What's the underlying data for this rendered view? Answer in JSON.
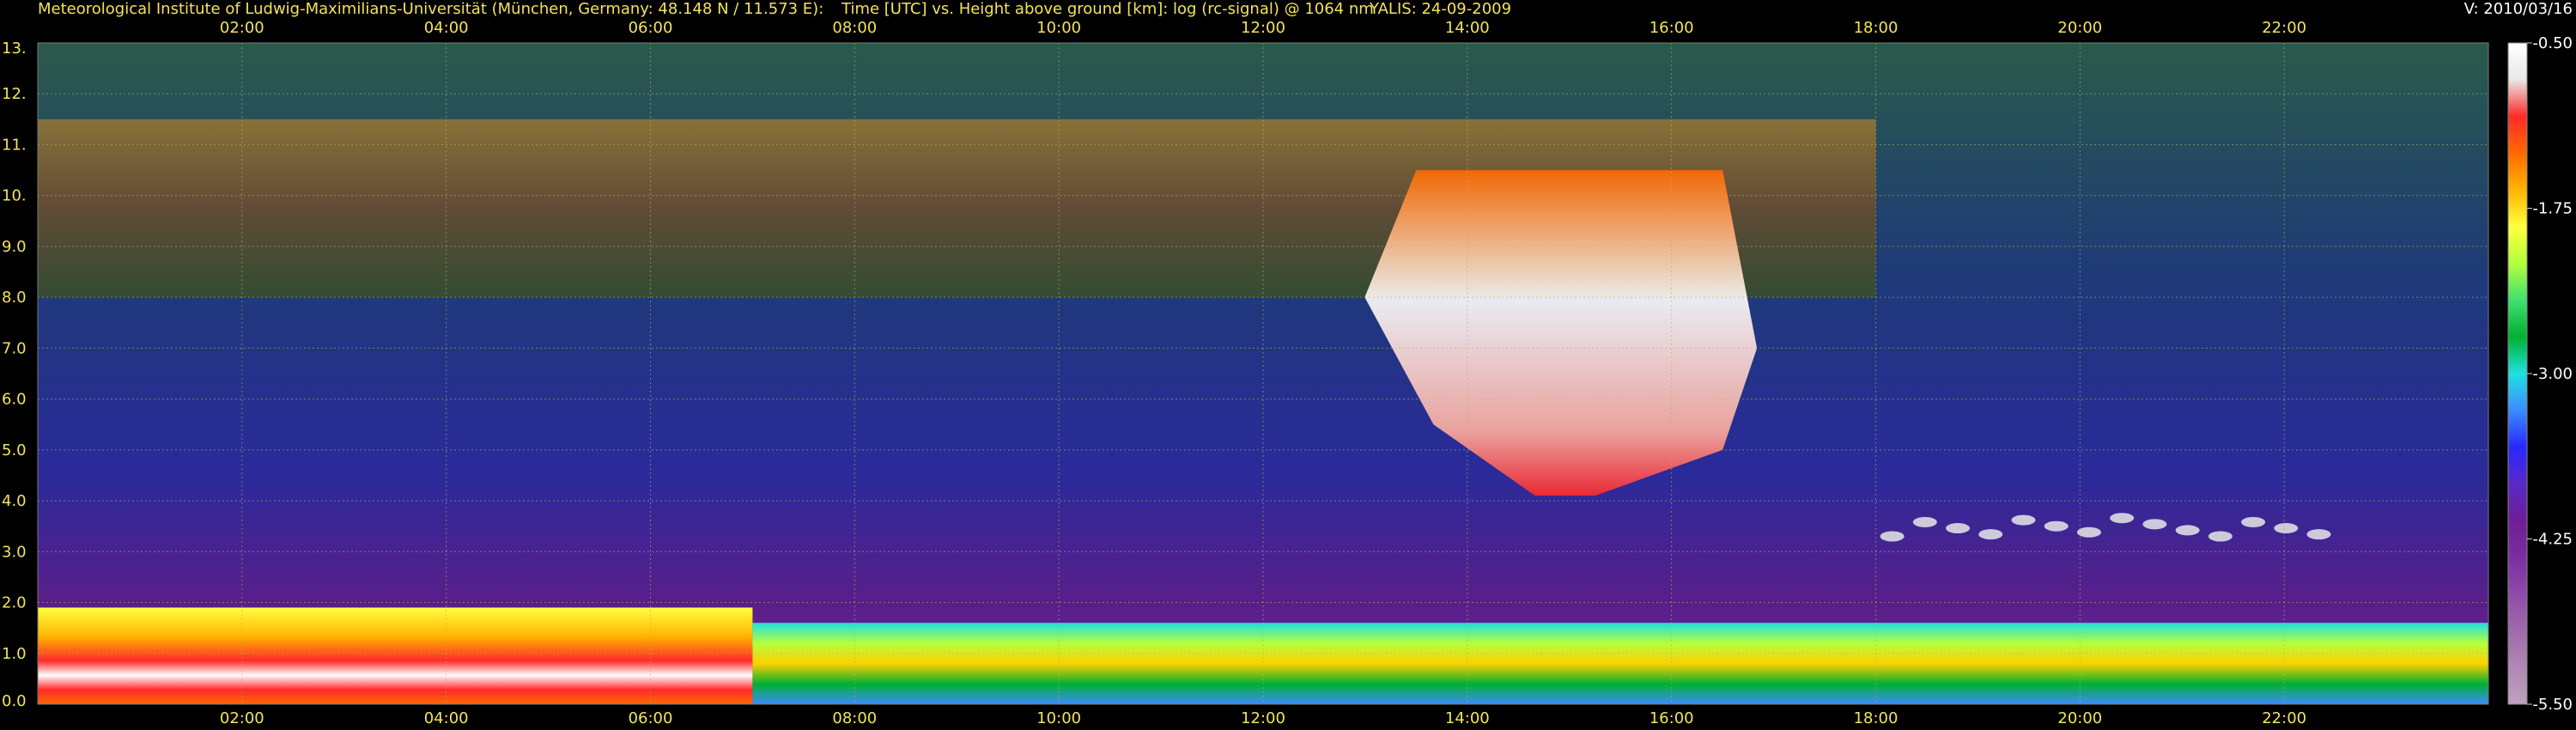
{
  "header": {
    "institute": "Meteorological Institute of Ludwig-Maximilians-Universität (München, Germany: 48.148 N / 11.573 E):",
    "plot_title": "Time [UTC] vs. Height above ground [km]: log (rc-signal) @ 1064 nm",
    "instrument": "YALIS: 24-09-2009",
    "version": "V: 2010/03/16"
  },
  "colors": {
    "header_text": "#f2e35a",
    "grid": "#b8b060",
    "background": "#000000"
  },
  "chart_data": {
    "type": "heatmap",
    "title": "Time [UTC] vs. Height above ground [km]: log (rc-signal) @ 1064 nm",
    "x_unit": "Time [UTC]",
    "y_unit": "Height above ground [km]",
    "xlim": [
      0.0,
      24.0
    ],
    "ylim": [
      0.0,
      13.0
    ],
    "x_ticks": [
      "02:00",
      "04:00",
      "06:00",
      "08:00",
      "10:00",
      "12:00",
      "14:00",
      "16:00",
      "18:00",
      "20:00",
      "22:00"
    ],
    "x_tick_values": [
      2,
      4,
      6,
      8,
      10,
      12,
      14,
      16,
      18,
      20,
      22
    ],
    "y_ticks": [
      "0.0",
      "1.0",
      "2.0",
      "3.0",
      "4.0",
      "5.0",
      "6.0",
      "7.0",
      "8.0",
      "9.0",
      "10.",
      "11.",
      "12.",
      "13."
    ],
    "y_tick_values": [
      0,
      1,
      2,
      3,
      4,
      5,
      6,
      7,
      8,
      9,
      10,
      11,
      12,
      13
    ],
    "grid": true,
    "colorbar": {
      "label_values": [
        "-0.50",
        "-1.75",
        "-3.00",
        "-4.25",
        "-5.50"
      ],
      "range": [
        -5.5,
        -0.5
      ],
      "colors_top_to_bottom": [
        "#ffffff",
        "#e8e8e8",
        "#ff2a2a",
        "#ff6a00",
        "#ffb400",
        "#ffff40",
        "#b4ff3c",
        "#40e070",
        "#00b030",
        "#20e0e0",
        "#3c8cff",
        "#2828ff",
        "#5a28c8",
        "#6e1e96",
        "#7a2ea0",
        "#8e4ca8",
        "#a06aac",
        "#b088b4",
        "#c0a0c0"
      ]
    },
    "features": [
      {
        "name": "boundary-layer aerosol (high signal)",
        "t_start": 0.0,
        "t_end": 7.0,
        "h_bottom": 0.0,
        "h_top": 1.9,
        "level": -1.0
      },
      {
        "name": "boundary-layer aerosol",
        "t_start": 7.0,
        "t_end": 24.0,
        "h_bottom": 0.0,
        "h_top": 1.6,
        "level": -2.0
      },
      {
        "name": "cirrus band",
        "t_start": 0.0,
        "t_end": 18.0,
        "h_bottom": 8.0,
        "h_top": 11.5,
        "level": -1.0
      },
      {
        "name": "thick cloud",
        "t_start": 13.5,
        "t_end": 16.5,
        "h_bottom": 4.1,
        "h_top": 10.5,
        "level": -0.5
      },
      {
        "name": "low clouds",
        "t_start": 18.0,
        "t_end": 22.5,
        "h_bottom": 3.0,
        "h_top": 4.0,
        "level": -0.5
      }
    ]
  }
}
